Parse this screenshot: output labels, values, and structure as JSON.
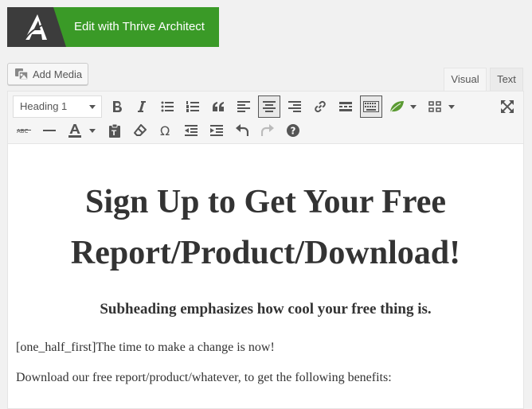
{
  "thrive": {
    "label": "Edit with Thrive Architect"
  },
  "media": {
    "label": "Add Media"
  },
  "tabs": {
    "visual": "Visual",
    "text": "Text"
  },
  "toolbar": {
    "format": "Heading 1",
    "row1_icons": [
      "bold-icon",
      "italic-icon",
      "bullet-list-icon",
      "numbered-list-icon",
      "blockquote-icon",
      "align-left-icon",
      "align-center-icon",
      "align-right-icon",
      "link-icon",
      "read-more-icon",
      "toolbar-toggle-icon",
      "leaf-icon",
      "grid-icon",
      "fullscreen-icon"
    ],
    "row2_icons": [
      "strikethrough-icon",
      "horizontal-line-icon",
      "text-color-icon",
      "paste-text-icon",
      "clear-formatting-icon",
      "special-character-icon",
      "outdent-icon",
      "indent-icon",
      "undo-icon",
      "redo-icon",
      "help-icon"
    ]
  },
  "content": {
    "heading_line1": "Sign Up to Get Your Free",
    "heading_line2": "Report/Product/Download!",
    "subheading": "Subheading emphasizes how cool your free thing is.",
    "para1": "[one_half_first]The time to make a change is now!",
    "para2": "Download our free report/product/whatever, to get the following benefits:"
  },
  "colors": {
    "thrive_green": "#3a9a27",
    "logo_dark": "#3c3c3c",
    "text": "#333333"
  }
}
